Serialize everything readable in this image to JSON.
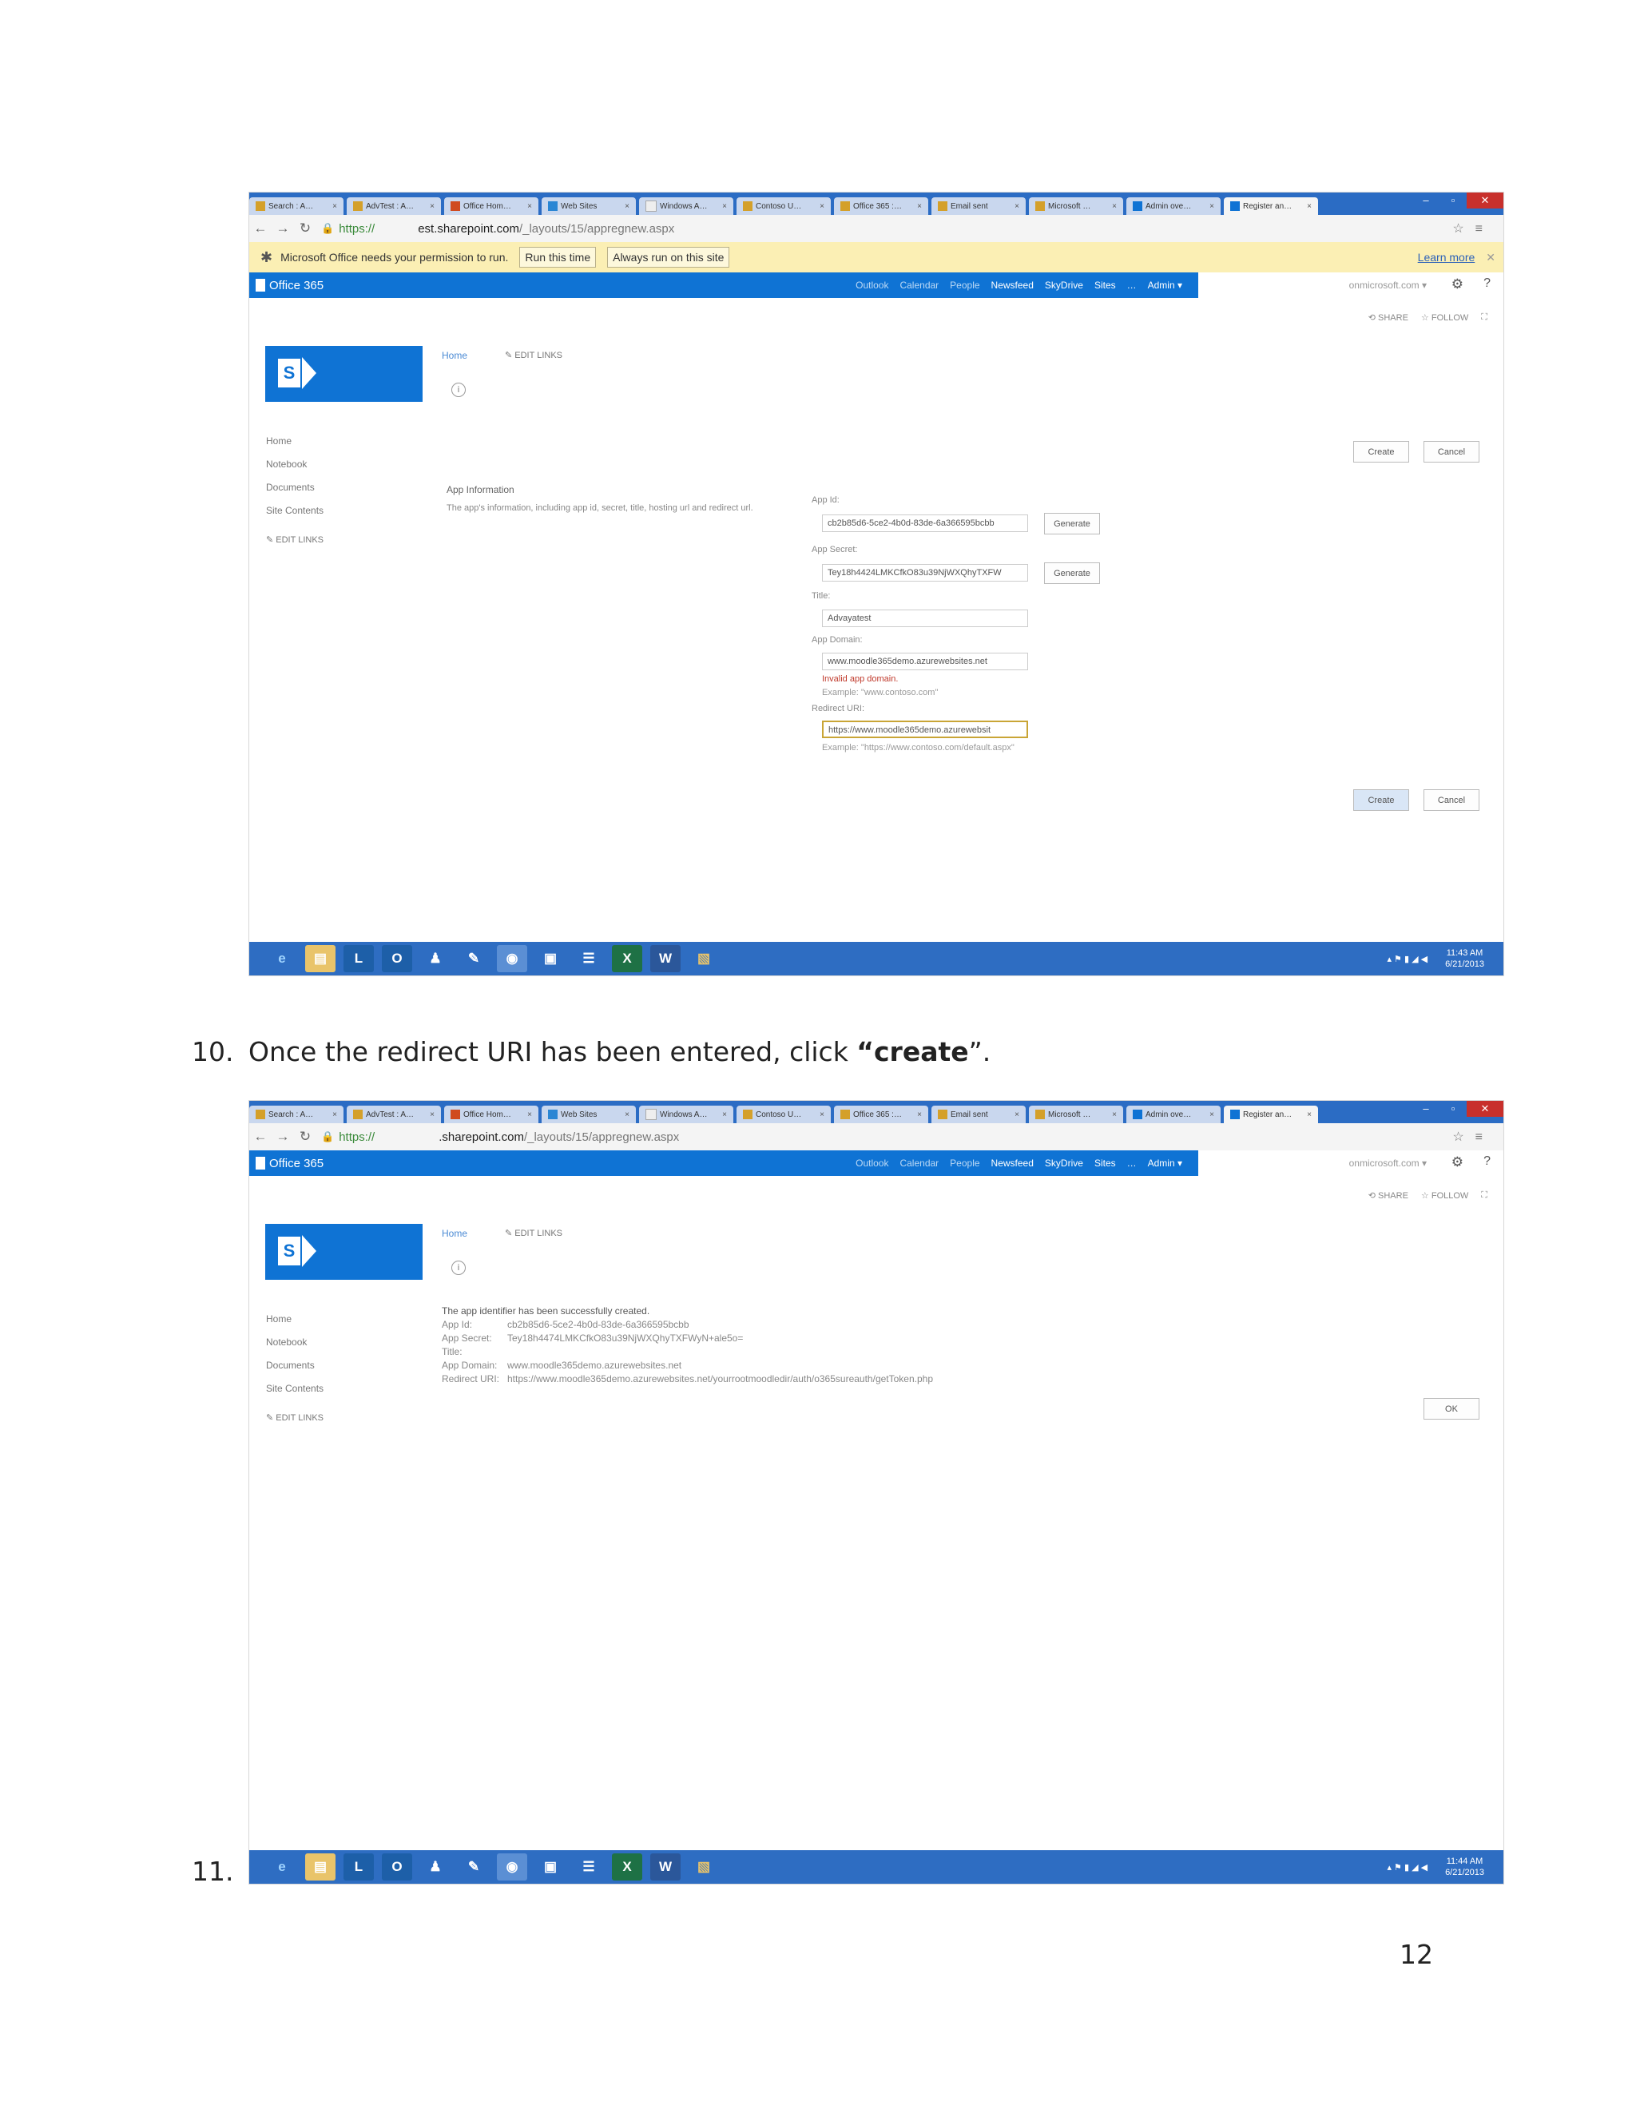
{
  "screenshot1": {
    "tabs": [
      "Search : A…",
      "AdvTest : A…",
      "Office Hom…",
      "Web Sites",
      "Windows A…",
      "Contoso U…",
      "Office 365 :…",
      "Email sent",
      "Microsoft …",
      "Admin ove…",
      "Register an…"
    ],
    "address": {
      "scheme": "https://",
      "host": "est.sharepoint.com",
      "path": "/_layouts/15/appregnew.aspx"
    },
    "infobar": {
      "message": "Microsoft Office needs your permission to run.",
      "run_once": "Run this time",
      "always_run": "Always run on this site",
      "learn_more": "Learn more"
    },
    "suitebar": {
      "brand": "Office 365",
      "links": [
        "Outlook",
        "Calendar",
        "People",
        "Newsfeed",
        "SkyDrive",
        "Sites",
        "…",
        "Admin ▾"
      ],
      "account": "onmicrosoft.com ▾"
    },
    "share_follow": [
      "SHARE",
      "FOLLOW"
    ],
    "breadcrumb": "Home",
    "edit_links": "EDIT LINKS",
    "left_nav": [
      "Home",
      "Notebook",
      "Documents",
      "Site Contents"
    ],
    "buttons": {
      "create": "Create",
      "cancel": "Cancel",
      "generate": "Generate"
    },
    "section_title": "App Information",
    "section_desc": "The app's information, including app id, secret, title, hosting url and redirect url.",
    "fields": {
      "app_id_label": "App Id:",
      "app_id_value": "cb2b85d6-5ce2-4b0d-83de-6a366595bcbb",
      "app_secret_label": "App Secret:",
      "app_secret_value": "Tey18h4424LMKCfkO83u39NjWXQhyTXFW",
      "title_label": "Title:",
      "title_value": "Advayatest",
      "app_domain_label": "App Domain:",
      "app_domain_value": "www.moodle365demo.azurewebsites.net",
      "app_domain_error": "Invalid app domain.",
      "app_domain_example": "Example: \"www.contoso.com\"",
      "redirect_label": "Redirect URI:",
      "redirect_value": "https://www.moodle365demo.azurewebsit",
      "redirect_example": "Example: \"https://www.contoso.com/default.aspx\""
    },
    "taskbar": {
      "time": "11:43 AM",
      "date": "6/21/2013"
    }
  },
  "step10": {
    "number": "10.",
    "prefix": "Once the redirect URI has been entered, click ",
    "bold": "“create",
    "suffix": "”."
  },
  "screenshot2": {
    "address": {
      "scheme": "https://",
      "host": ".sharepoint.com",
      "path": "/_layouts/15/appregnew.aspx"
    },
    "success_title": "The app identifier has been successfully created.",
    "details": [
      {
        "label": "App Id:",
        "value": "cb2b85d6-5ce2-4b0d-83de-6a366595bcbb"
      },
      {
        "label": "App Secret:",
        "value": "Tey18h4474LMKCfkO83u39NjWXQhyTXFWyN+ale5o="
      },
      {
        "label": "Title:",
        "value": ""
      },
      {
        "label": "App Domain:",
        "value": "www.moodle365demo.azurewebsites.net"
      },
      {
        "label": "Redirect URI:",
        "value": "https://www.moodle365demo.azurewebsites.net/yourrootmoodledir/auth/o365sureauth/getToken.php"
      }
    ],
    "ok": "OK",
    "taskbar": {
      "time": "11:44 AM",
      "date": "6/21/2013"
    }
  },
  "step11": {
    "number": "11."
  },
  "page_number": "12",
  "colors": {
    "o365_blue": "#0f73d4",
    "tab_blue": "#2b6cc4",
    "infobar": "#fbefb4",
    "error": "#c0392b"
  }
}
